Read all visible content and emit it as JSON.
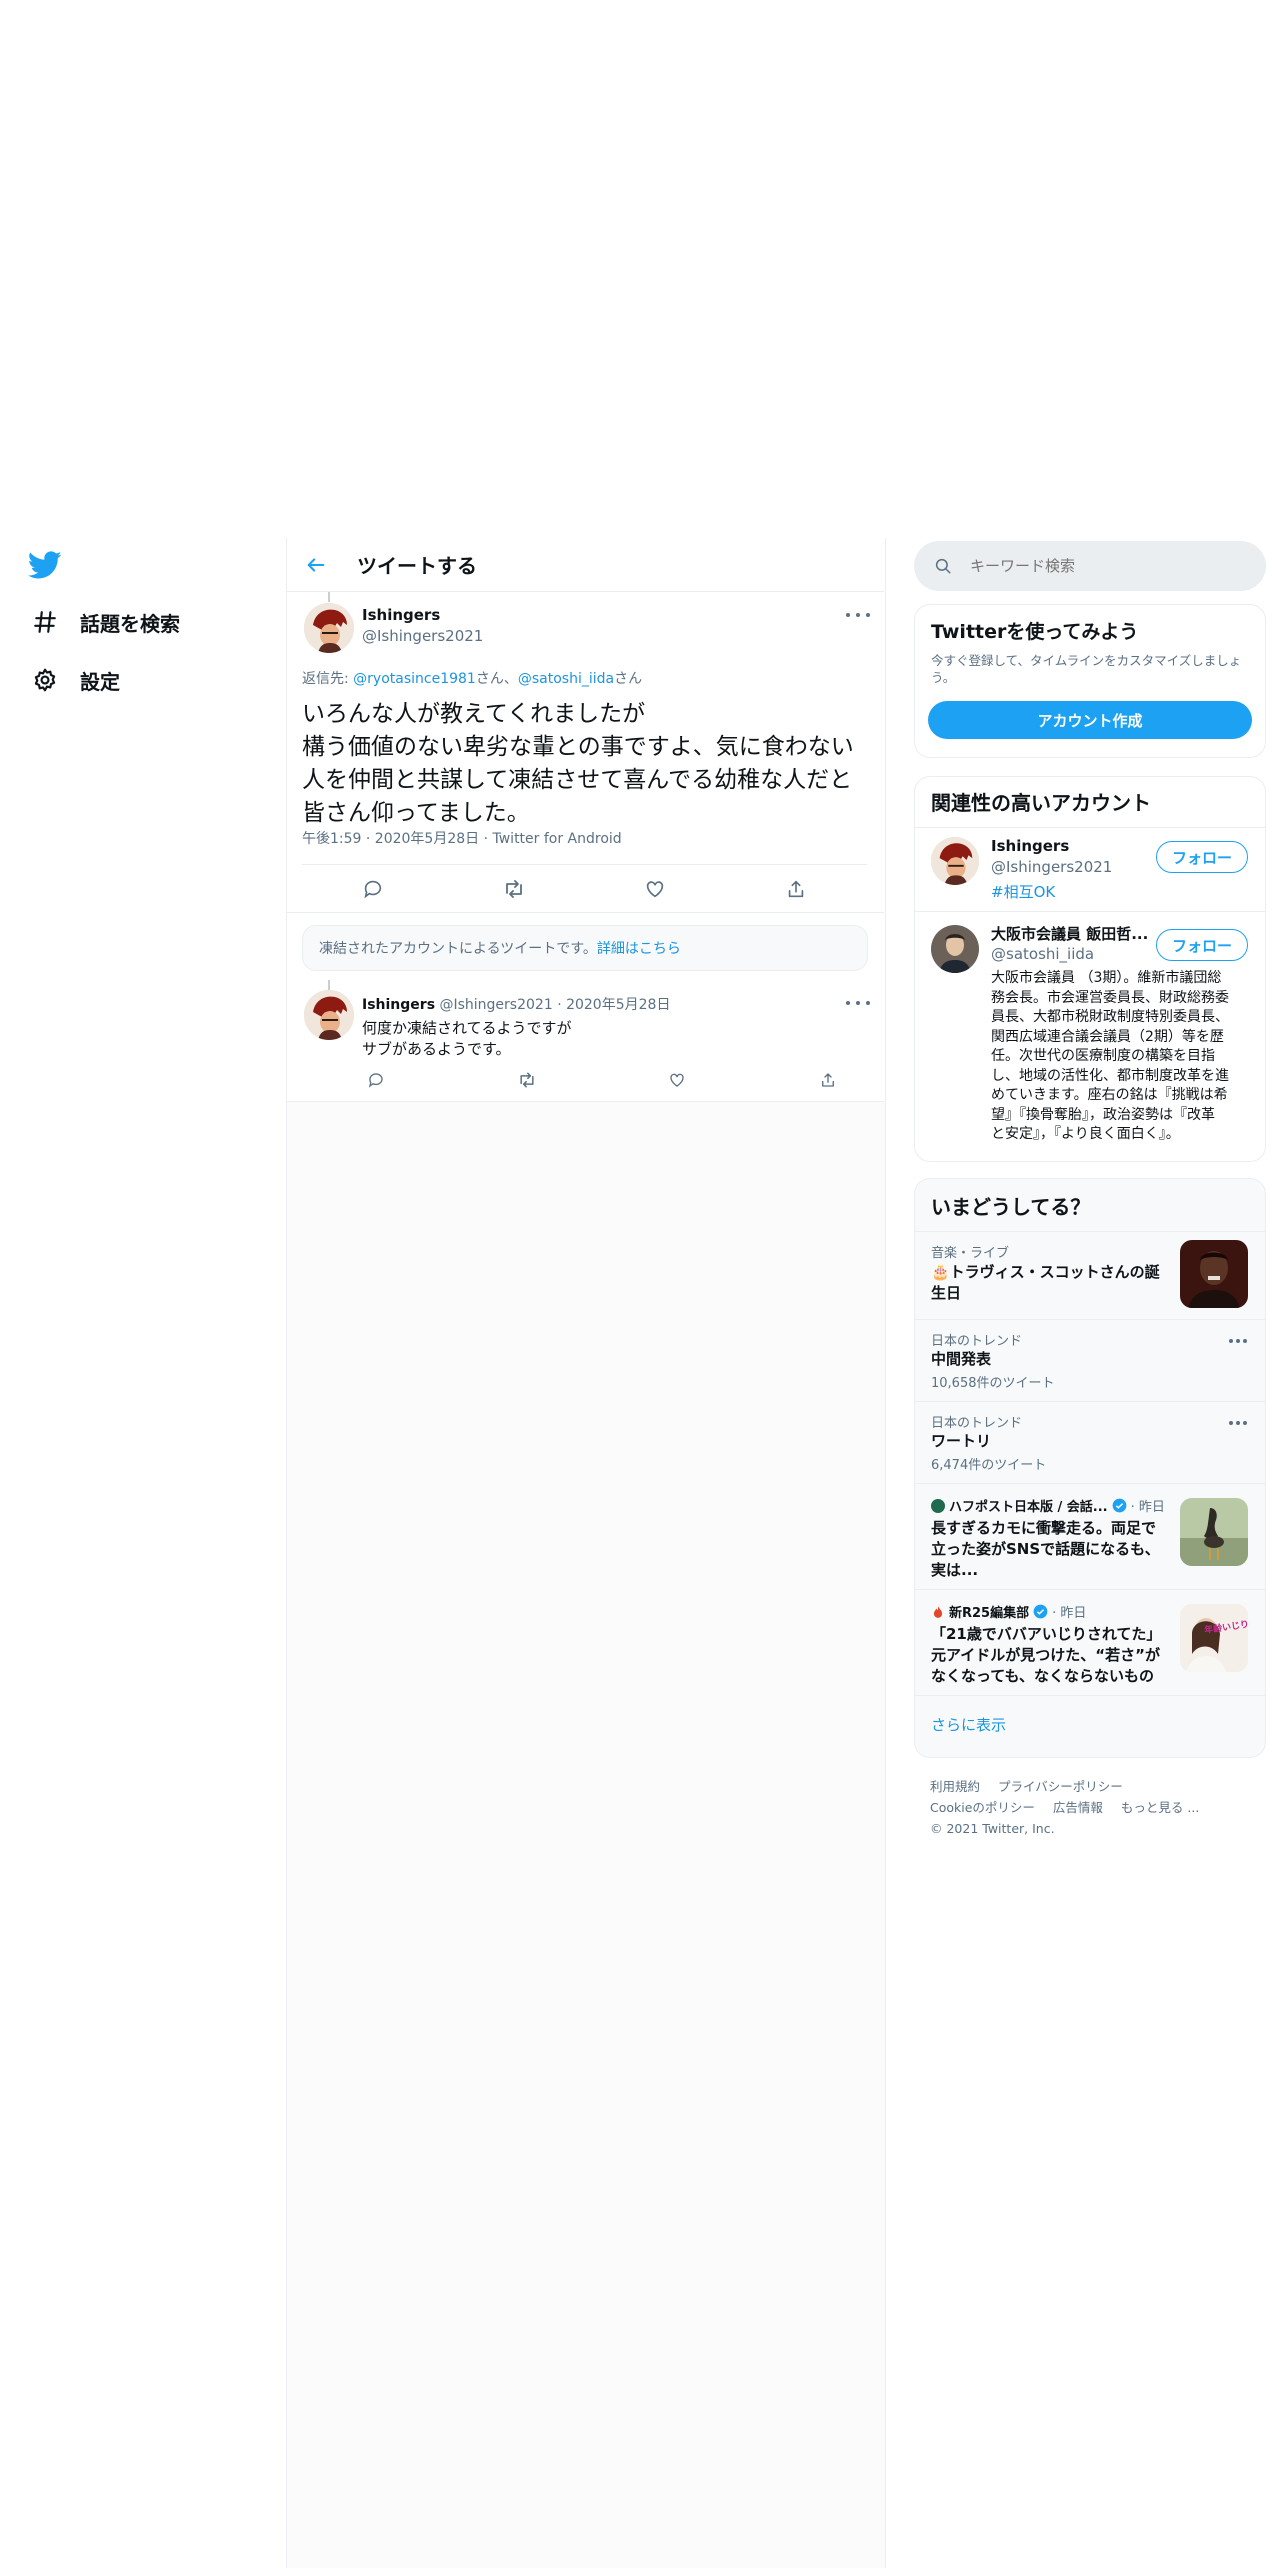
{
  "nav": {
    "explore_label": "話題を検索",
    "settings_label": "設定"
  },
  "header": {
    "title": "ツイートする"
  },
  "main_tweet": {
    "name": "Ishingers",
    "handle": "@Ishingers2021",
    "reply_prefix": "返信先: ",
    "reply_user1": "@ryotasince1981",
    "reply_sep1": "さん、",
    "reply_user2": "@satoshi_iida",
    "reply_sep2": "さん",
    "text_lines": [
      "いろんな人が教えてくれましたが",
      "構う価値のない卑劣な輩との事ですよ、気に食わない",
      "人を仲間と共謀して凍結させて喜んでる幼稚な人だと",
      "皆さん仰ってました。"
    ],
    "meta": "午後1:59 · 2020年5月28日 · Twitter for Android"
  },
  "suspended_notice": {
    "text": "凍結されたアカウントによるツイートです。",
    "link": "詳細はこちら"
  },
  "reply_tweet": {
    "name": "Ishingers",
    "handle": "@Ishingers2021",
    "date": "· 2020年5月28日",
    "line1": "何度か凍結されてるようですが",
    "line2": "サブがあるようです。"
  },
  "search": {
    "placeholder": "キーワード検索"
  },
  "signup_card": {
    "title": "Twitterを使ってみよう",
    "desc_line1": "今すぐ登録して、タイムラインをカスタマイズしましょ",
    "desc_line2": "う。",
    "button": "アカウント作成"
  },
  "related_card": {
    "title": "関連性の高いアカウント",
    "accounts": [
      {
        "name": "Ishingers",
        "handle": "@Ishingers2021",
        "bio_lines": [
          "#相互OK"
        ],
        "follow": "フォロー"
      },
      {
        "name": "大阪市会議員 飯田哲...",
        "handle": "@satoshi_iida",
        "bio_lines": [
          "大阪市会議員 （3期）。維新市議団総",
          "務会長。市会運営委員長、財政総務委",
          "員長、大都市税財政制度特別委員長、",
          "関西広域連合議会議員（2期）等を歴",
          "任。次世代の医療制度の構築を目指",
          "し、地域の活性化、都市制度改革を進",
          "めていきます。座右の銘は『挑戦は希",
          "望』『換骨奪胎』，政治姿勢は『改革",
          "と安定』，『より良く面白く』。"
        ],
        "follow": "フォロー"
      }
    ]
  },
  "trends_card": {
    "title": "いまどうしてる？",
    "items": [
      {
        "category": "音楽・ライブ",
        "title_line1": "🎂トラヴィス・スコットさんの誕",
        "title_line2": "生日"
      },
      {
        "category": "日本のトレンド",
        "title": "中間発表",
        "count": "10,658件のツイート"
      },
      {
        "category": "日本のトレンド",
        "title": "ワートリ",
        "count": "6,474件のツイート"
      },
      {
        "source": "ハフポスト日本版 / 会話...",
        "time": "· 昨日",
        "title_lines": [
          "長すぎるカモに衝撃走る。両足で",
          "立った姿がSNSで話題になるも、",
          "実は..."
        ]
      },
      {
        "source": "新R25編集部",
        "time": "· 昨日",
        "title_lines": [
          "「21歳でババアいじりされてた」",
          "元アイドルが見つけた、“若さ”が",
          "なくなっても、なくならないもの"
        ],
        "thumb_text": "年齢いじり"
      }
    ],
    "show_more": "さらに表示"
  },
  "footer": {
    "links_row1": [
      "利用規約",
      "プライバシーポリシー"
    ],
    "links_row2": [
      "Cookieのポリシー",
      "広告情報",
      "もっと見る ..."
    ],
    "copyright": "© 2021 Twitter, Inc."
  },
  "colors": {
    "accent": "#1da1f2",
    "link": "#1b95e0",
    "muted": "#5b7083",
    "card_bg": "#f7f9fa",
    "border": "#ebeef0"
  },
  "icons": [
    "twitter-logo-icon",
    "hashtag-icon",
    "gear-icon",
    "back-arrow-icon",
    "more-icon",
    "reply-icon",
    "retweet-icon",
    "like-icon",
    "share-icon",
    "search-icon",
    "verified-icon"
  ]
}
